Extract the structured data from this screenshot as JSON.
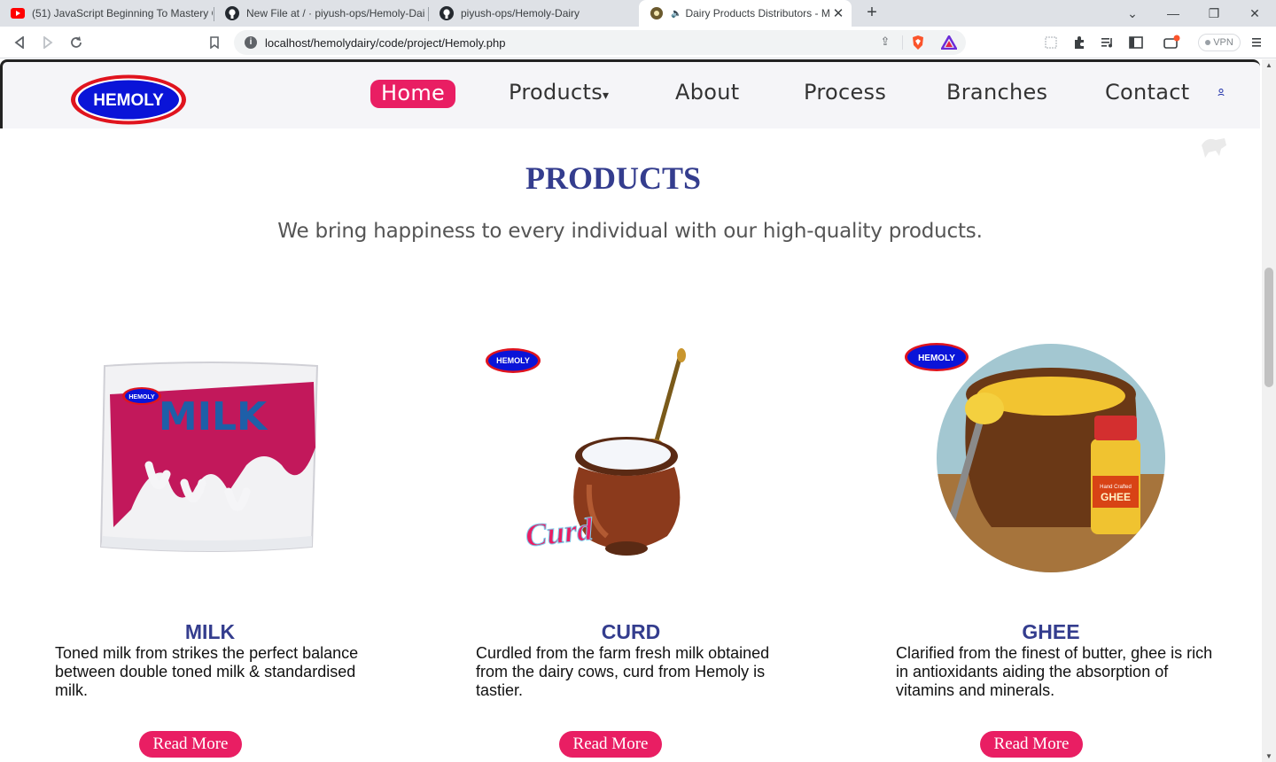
{
  "browser": {
    "tabs": [
      {
        "title": "(51) JavaScript Beginning To Mastery C",
        "icon": "youtube-icon"
      },
      {
        "title": "New File at / · piyush-ops/Hemoly-Dai",
        "icon": "github-icon"
      },
      {
        "title": "piyush-ops/Hemoly-Dairy",
        "icon": "github-icon"
      },
      {
        "title": "Dairy Products Distributors - M",
        "icon": "site-favicon",
        "active": true
      }
    ],
    "url": "localhost/hemolydairy/code/project/Hemoly.php",
    "vpn_label": "VPN"
  },
  "site": {
    "logo_text": "HEMOLY",
    "nav": {
      "home": "Home",
      "products": "Products",
      "products_caret": "▾",
      "about": "About",
      "process": "Process",
      "branches": "Branches",
      "contact": "Contact"
    }
  },
  "products": {
    "heading": "PRODUCTS",
    "subheading": "We bring happiness to every individual with our high-quality products.",
    "items": [
      {
        "title": "MILK",
        "description": "Toned milk from strikes the perfect balance between double toned milk & standardised milk.",
        "button": "Read More",
        "image_labels": {
          "brand": "HEMOLY",
          "text": "MILK"
        }
      },
      {
        "title": "CURD",
        "description": "Curdled from the farm fresh milk obtained from the dairy cows, curd from Hemoly is tastier.",
        "button": "Read More",
        "image_labels": {
          "brand": "HEMOLY",
          "text": "Curd"
        }
      },
      {
        "title": "GHEE",
        "description": "Clarified from the finest of butter, ghee is rich in antioxidants aiding the absorption of vitamins and minerals.",
        "button": "Read More",
        "image_labels": {
          "brand": "HEMOLY",
          "text": "GHEE",
          "subtext": "Hand Crafted"
        }
      }
    ]
  },
  "colors": {
    "accent": "#e91e63",
    "heading": "#343d8e",
    "logo_blue": "#0a14d8",
    "logo_red": "#e0141e"
  }
}
